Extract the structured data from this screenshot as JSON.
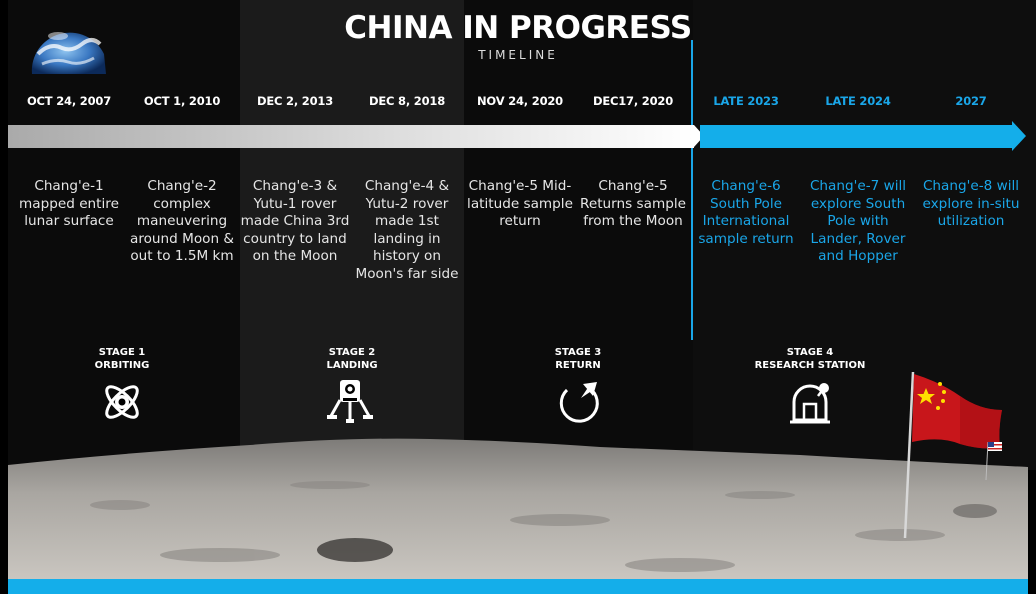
{
  "header": {
    "title": "CHINA IN PROGRESS",
    "subtitle": "TIMELINE"
  },
  "events": [
    {
      "date": "OCT 24, 2007",
      "text": "Chang'e-1 mapped entire lunar surface"
    },
    {
      "date": "OCT 1, 2010",
      "text": "Chang'e-2 complex maneuvering around Moon & out to 1.5M km"
    },
    {
      "date": "DEC 2, 2013",
      "text": "Chang'e-3 & Yutu-1 rover made China 3rd country to land on the Moon"
    },
    {
      "date": "DEC 8, 2018",
      "text": "Chang'e-4 & Yutu-2 rover made 1st landing in history on Moon's far side"
    },
    {
      "date": "NOV 24, 2020",
      "text": "Chang'e-5 Mid-latitude sample return"
    },
    {
      "date": "DEC17, 2020",
      "text": "Chang'e-5 Returns sample from the Moon"
    },
    {
      "date": "LATE 2023",
      "text": "Chang'e-6 South Pole International sample return"
    },
    {
      "date": "LATE 2024",
      "text": "Chang'e-7 will explore South Pole with Lander, Rover and Hopper"
    },
    {
      "date": "2027",
      "text": "Chang'e-8 will explore in-situ utilization"
    }
  ],
  "stages": [
    {
      "label": "STAGE 1\nORBITING",
      "icon": "orbit-icon"
    },
    {
      "label": "STAGE 2\nLANDING",
      "icon": "lander-icon"
    },
    {
      "label": "STAGE 3\nRETURN",
      "icon": "return-icon"
    },
    {
      "label": "STAGE 4\nRESEARCH STATION",
      "icon": "research-station-icon"
    }
  ],
  "colors": {
    "accent": "#14aeea",
    "past_text": "#e6e6e6",
    "background": "#000000"
  }
}
